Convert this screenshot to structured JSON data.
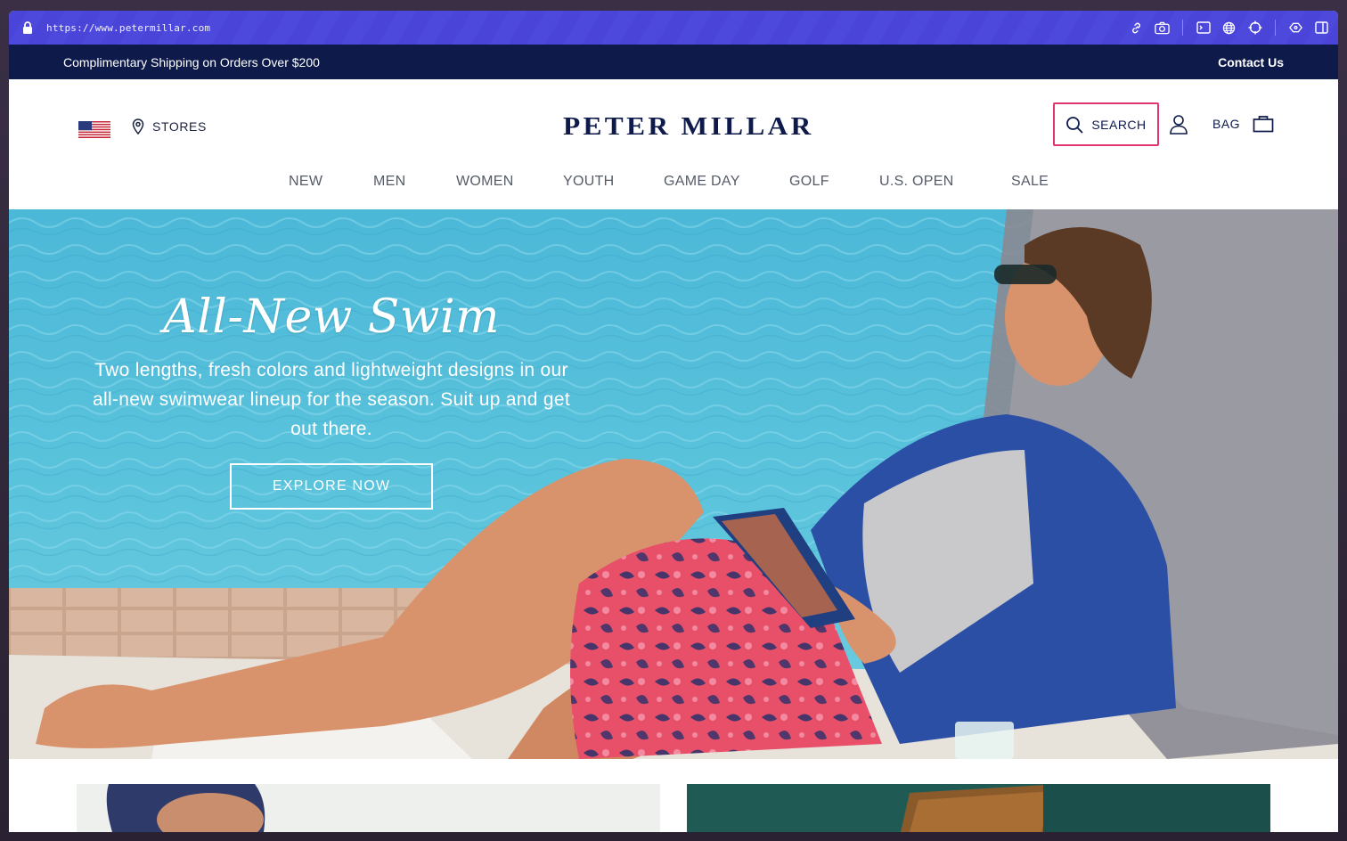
{
  "browser": {
    "url": "https://www.petermillar.com",
    "tools": [
      "link-icon",
      "camera-icon",
      "terminal-icon",
      "globe-icon",
      "crosshair-icon",
      "extension-icon",
      "sidebar-icon"
    ]
  },
  "promo": {
    "text": "Complimentary Shipping on Orders Over $200",
    "contact_label": "Contact Us"
  },
  "header": {
    "stores_label": "STORES",
    "logo_text": "PETER MILLAR",
    "search_label": "SEARCH",
    "bag_label": "BAG"
  },
  "nav": {
    "items": [
      "NEW",
      "MEN",
      "WOMEN",
      "YOUTH",
      "GAME DAY",
      "GOLF",
      "U.S. OPEN",
      "SALE"
    ]
  },
  "hero": {
    "title": "All-New Swim",
    "subtitle": "Two lengths, fresh colors and lightweight designs in our all-new swimwear lineup for the season. Suit up and get out there.",
    "cta_label": "EXPLORE NOW"
  },
  "colors": {
    "browser_bar": "#4a45d8",
    "promo_bar": "#0d1a4a",
    "brand_navy": "#0d1a4a",
    "search_highlight": "#e0356f",
    "nav_text": "#555b67"
  }
}
